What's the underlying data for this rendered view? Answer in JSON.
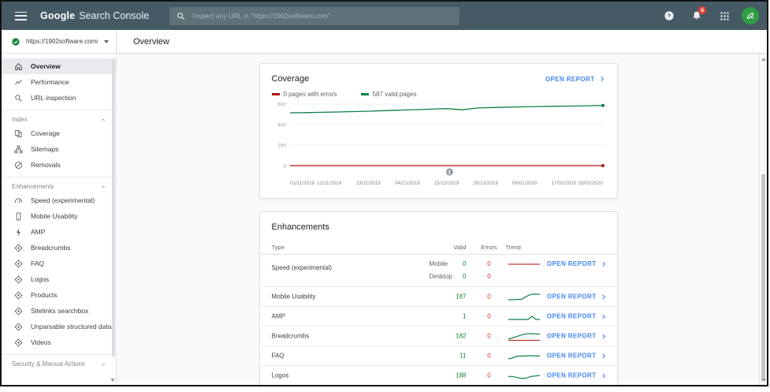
{
  "colors": {
    "topbar_bg": "#455a64",
    "link_blue": "#4285f4",
    "valid_green": "#188038",
    "error_red": "#d93025",
    "line_green": "#0d8043",
    "line_red": "#b31412"
  },
  "topbar": {
    "brand_part1": "Google",
    "brand_part2": "Search Console",
    "search_placeholder": "Inspect any URL in \"https://1902software.com\"",
    "notification_badge": "8"
  },
  "sidebar": {
    "property": {
      "url": "https://1902software.com/"
    },
    "primary": [
      {
        "label": "Overview",
        "selected": true
      },
      {
        "label": "Performance"
      },
      {
        "label": "URL inspection"
      }
    ],
    "sections": [
      {
        "title": "Index",
        "items": [
          {
            "label": "Coverage"
          },
          {
            "label": "Sitemaps"
          },
          {
            "label": "Removals"
          }
        ]
      },
      {
        "title": "Enhancements",
        "items": [
          {
            "label": "Speed (experimental)"
          },
          {
            "label": "Mobile Usability"
          },
          {
            "label": "AMP"
          },
          {
            "label": "Breadcrumbs"
          },
          {
            "label": "FAQ"
          },
          {
            "label": "Logos"
          },
          {
            "label": "Products"
          },
          {
            "label": "Sitelinks searchbox"
          },
          {
            "label": "Unparsable structured data"
          },
          {
            "label": "Videos"
          }
        ]
      },
      {
        "title": "Security & Manual Actions",
        "collapsed": true,
        "items": []
      }
    ]
  },
  "main": {
    "page_title": "Overview",
    "coverage": {
      "title": "Coverage",
      "open_report": "OPEN REPORT",
      "legend": [
        {
          "label": "0 pages with errors",
          "color": "#b31412"
        },
        {
          "label": "587 valid pages",
          "color": "#0d8043"
        }
      ],
      "chart_data": {
        "type": "line",
        "x_labels": [
          "01/11/2019",
          "12/11/2019",
          "23/11/2019",
          "04/12/2019",
          "15/12/2019",
          "26/12/2019",
          "06/01/2020",
          "17/01/2020",
          "28/01/2020"
        ],
        "ylim": [
          0,
          600
        ],
        "yticks": [
          0,
          200,
          400,
          600
        ],
        "grid": true,
        "legend_position": "top",
        "annotation": {
          "label": "1",
          "x_frac": 0.51
        },
        "series": [
          {
            "name": "0 pages with errors",
            "color": "#b31412",
            "values": [
              0,
              0,
              0,
              0,
              0,
              0,
              0,
              0,
              0,
              0,
              0,
              0,
              0,
              0,
              0,
              0,
              0,
              0,
              0,
              0,
              0
            ]
          },
          {
            "name": "587 valid pages",
            "color": "#0d8043",
            "values": [
              515,
              517,
              520,
              523,
              527,
              531,
              536,
              541,
              546,
              551,
              556,
              545,
              562,
              567,
              571,
              574,
              577,
              579,
              581,
              584,
              587
            ]
          }
        ]
      }
    },
    "enhancements": {
      "title": "Enhancements",
      "columns": [
        "Type",
        "Valid",
        "Errors",
        "Trend"
      ],
      "open_report": "OPEN REPORT",
      "rows": [
        {
          "type": "Speed (experimental)",
          "subrows": [
            {
              "device": "Mobile",
              "valid": "0",
              "errors": "0"
            },
            {
              "device": "Desktop",
              "valid": "0",
              "errors": "0"
            }
          ],
          "trend": {
            "red": [
              0,
              0,
              0,
              0,
              0,
              0
            ]
          }
        },
        {
          "type": "Mobile Usability",
          "valid": "187",
          "errors": "0",
          "trend": {
            "green": [
              150,
              150,
              152,
              153,
              172,
              186,
              187,
              187
            ]
          }
        },
        {
          "type": "AMP",
          "valid": "1",
          "errors": "0",
          "trend": {
            "green": [
              1,
              1,
              1,
              1,
              1,
              1,
              2,
              1,
              1
            ]
          }
        },
        {
          "type": "Breadcrumbs",
          "valid": "182",
          "errors": "0",
          "trend": {
            "green": [
              156,
              163,
              170,
              177,
              182,
              183,
              182,
              181
            ],
            "red": [
              0,
              0,
              0,
              0,
              0,
              0,
              0,
              0
            ]
          }
        },
        {
          "type": "FAQ",
          "valid": "11",
          "errors": "0",
          "trend": {
            "green": [
              2,
              4,
              9,
              10,
              10,
              11,
              11,
              10,
              11
            ]
          }
        },
        {
          "type": "Logos",
          "valid": "188",
          "errors": "0",
          "trend": {
            "green": [
              186,
              186,
              184,
              182,
              183,
              186,
              187,
              188
            ]
          }
        }
      ]
    }
  }
}
